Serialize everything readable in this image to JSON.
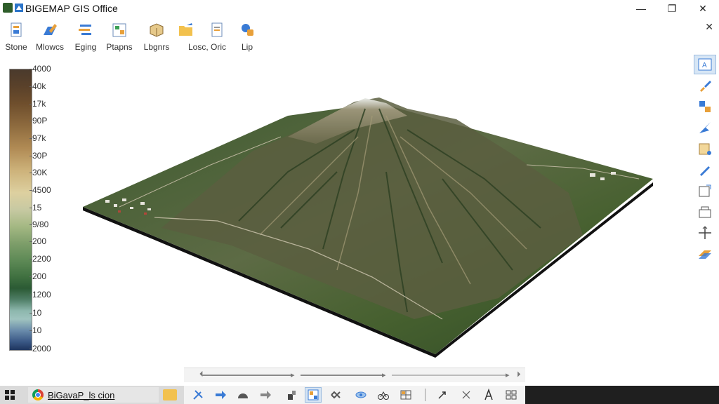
{
  "window": {
    "title": "BIGEMAP GIS Office",
    "controls": {
      "minimize": "—",
      "maximize": "❐",
      "close": "✕"
    }
  },
  "toolbar": {
    "items": [
      {
        "label": "Stone",
        "icon": "page-icon"
      },
      {
        "label": "Mlowcs",
        "icon": "pencil-icon"
      },
      {
        "label": "Eging",
        "icon": "layers-icon"
      },
      {
        "label": "Ptapns",
        "icon": "map-sheet-icon"
      },
      {
        "label": "Lbgnrs",
        "icon": "box-icon"
      },
      {
        "label": "Losc, Oric",
        "icon": "folder-edit-icon"
      },
      {
        "label": "",
        "icon": "document-icon"
      },
      {
        "label": "Lip",
        "icon": "tag-icon"
      }
    ],
    "close": "✕"
  },
  "legend": {
    "labels": [
      "4000",
      "40k",
      "17k",
      "90P",
      "97k",
      "30P",
      "30K",
      "4500",
      "15",
      "9/80",
      "200",
      "2200",
      "200",
      "1200",
      "10",
      "10",
      "2000"
    ]
  },
  "palette": {
    "items": [
      "text-box-icon",
      "brush-icon",
      "swap-icon",
      "plane-icon",
      "folder-star-icon",
      "pen-icon",
      "frame-icon",
      "building-icon",
      "move-icon",
      "tiles-icon"
    ],
    "active_index": 0
  },
  "taskbar": {
    "app_label": "BiGavaP_ls cion",
    "tool_icons": [
      "wrench-icon",
      "arrow-right-icon",
      "arch-icon",
      "arrow-right-icon",
      "probe-icon",
      "map-grid-icon",
      "puzzle-icon",
      "eye-icon",
      "bike-icon",
      "table-icon",
      "cursor-icon",
      "cross-icon",
      "text-icon",
      "list-icon"
    ],
    "active_tool_index": 5
  },
  "colors": {
    "accent": "#3a7bd5",
    "active_bg": "#d7e6f5",
    "taskbar_bg": "#1f1f1f"
  }
}
